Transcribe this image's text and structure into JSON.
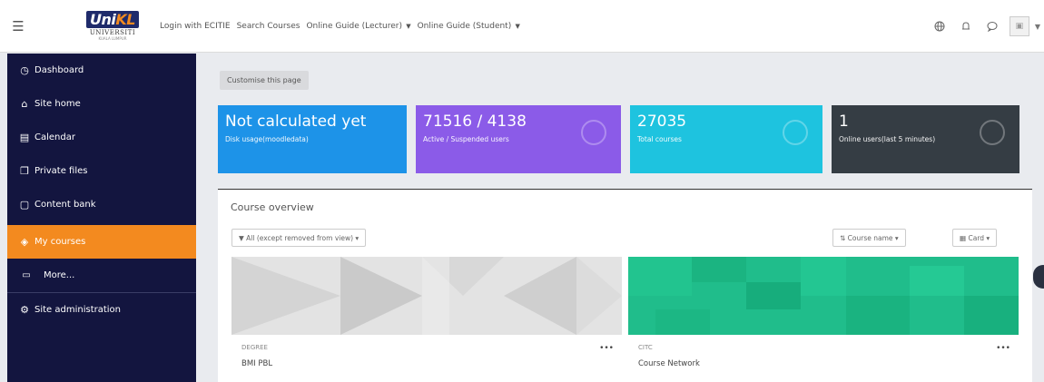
{
  "navbar": {
    "logo": {
      "brand_a": "Uni",
      "brand_b": "KL",
      "line1": "UNIVERSITI",
      "line2": "KUALA LUMPUR"
    },
    "links": [
      {
        "label": "Login with ECITIE",
        "dropdown": false
      },
      {
        "label": "Search Courses",
        "dropdown": false
      },
      {
        "label": "Online Guide (Lecturer)",
        "dropdown": true
      },
      {
        "label": "Online Guide (Student)",
        "dropdown": true
      }
    ],
    "icons": [
      "globe-icon",
      "bell-icon",
      "chat-icon",
      "avatar-icon"
    ]
  },
  "sidebar": {
    "items": [
      {
        "label": "Dashboard",
        "icon": "speedometer-icon"
      },
      {
        "label": "Site home",
        "icon": "home-icon"
      },
      {
        "label": "Calendar",
        "icon": "calendar-icon"
      },
      {
        "label": "Private files",
        "icon": "files-icon"
      },
      {
        "label": "Content bank",
        "icon": "bank-icon"
      },
      {
        "label": "My courses",
        "icon": "graduation-cap-icon",
        "active": true
      },
      {
        "label": "More...",
        "icon": "folder-icon"
      },
      {
        "label": "Site administration",
        "icon": "gear-icon"
      }
    ]
  },
  "main": {
    "customise_label": "Customise this page",
    "cards": [
      {
        "value": "Not calculated yet",
        "label": "Disk usage(moodledata)",
        "color": "#1d93e8"
      },
      {
        "value": "71516 / 4138",
        "label": "Active / Suspended users",
        "color": "#8b5be8"
      },
      {
        "value": "27035",
        "label": "Total courses",
        "color": "#1ec3df"
      },
      {
        "value": "1",
        "label": "Online users(last 5 minutes)",
        "color": "#353d44"
      }
    ],
    "overview": {
      "title": "Course overview",
      "filter": "All (except removed from view)",
      "sort": "Course name",
      "view": "Card",
      "courses": [
        {
          "category": "DEGREE",
          "name": "BMI PBL"
        },
        {
          "category": "CITC",
          "name": "Course Network"
        }
      ]
    }
  },
  "colors": {
    "sidebar_bg": "#13153f",
    "accent": "#f38a1f"
  }
}
